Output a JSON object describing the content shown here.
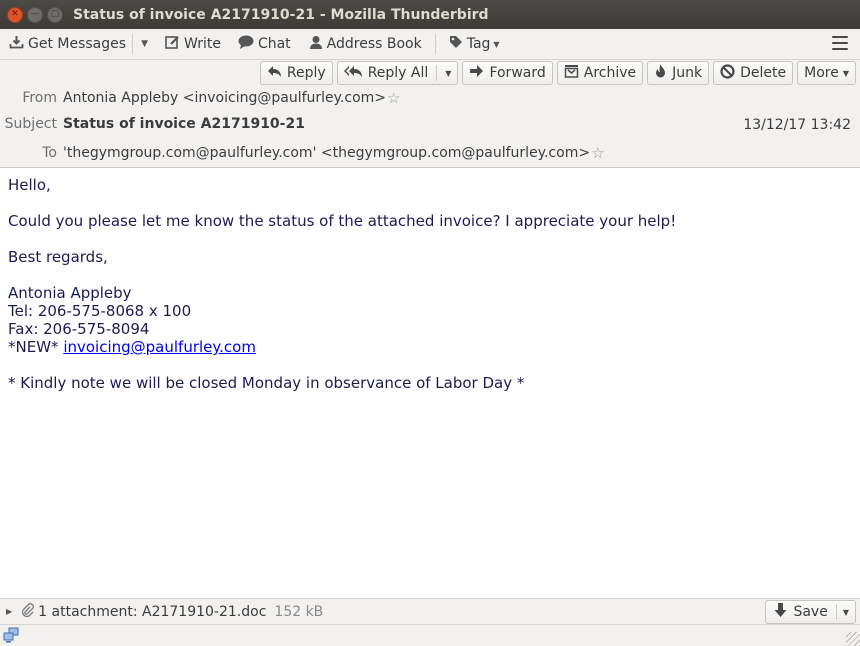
{
  "window": {
    "title": "Status of invoice A2171910-21 - Mozilla Thunderbird",
    "controls": [
      "close",
      "minimize",
      "maximize"
    ]
  },
  "toolbar": {
    "get_messages": "Get Messages",
    "write": "Write",
    "chat": "Chat",
    "address_book": "Address Book",
    "tag": "Tag",
    "icons": {
      "get_messages": "download-icon",
      "write": "pencil-icon",
      "chat": "chat-bubble-icon",
      "address_book": "person-icon",
      "tag": "tag-icon",
      "menu": "hamburger-menu-icon"
    }
  },
  "actions": {
    "reply": "Reply",
    "reply_all": "Reply All",
    "forward": "Forward",
    "archive": "Archive",
    "junk": "Junk",
    "delete": "Delete",
    "more": "More"
  },
  "header": {
    "from_label": "From",
    "from_value": "Antonia Appleby <invoicing@paulfurley.com>",
    "subject_label": "Subject",
    "subject_value": "Status of invoice A2171910-21",
    "to_label": "To",
    "to_value": "'thegymgroup.com@paulfurley.com' <thegymgroup.com@paulfurley.com>",
    "date": "13/12/17 13:42"
  },
  "message": {
    "greeting": "Hello,",
    "paragraph": "Could you please let me know the status of the attached invoice? I appreciate your help!",
    "closing": "Best regards,",
    "signature": {
      "name": "Antonia Appleby",
      "tel": "Tel: 206-575-8068 x 100",
      "fax": "Fax: 206-575-8094",
      "new_prefix": "*NEW* ",
      "email_link": "invoicing@paulfurley.com"
    },
    "note": "* Kindly note we will be closed Monday in observance of Labor Day *"
  },
  "attachments": {
    "summary": "1 attachment: A2171910-21.doc",
    "size": "152 kB",
    "save_label": "Save"
  }
}
